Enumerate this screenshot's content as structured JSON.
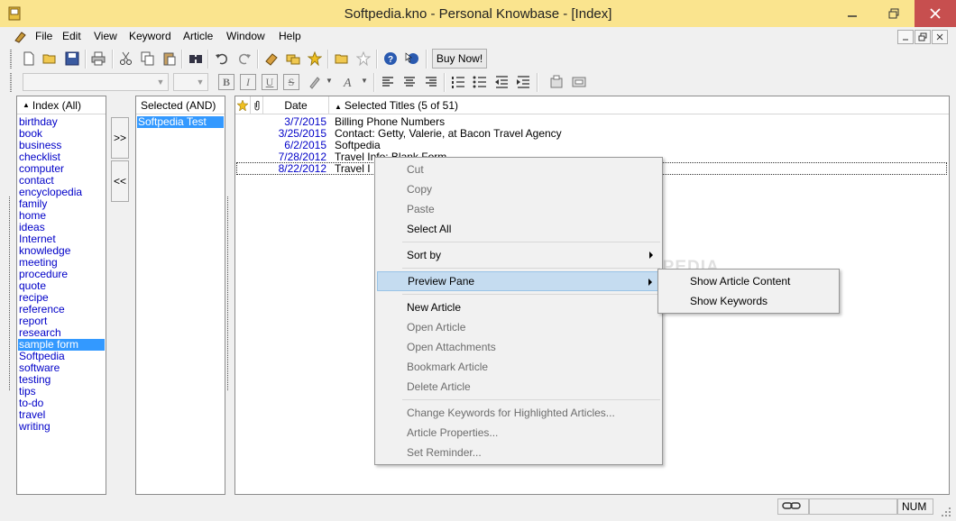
{
  "window": {
    "title": "Softpedia.kno - Personal Knowbase - [Index]",
    "accent_color": "#fae48e",
    "close_color": "#c74f4f"
  },
  "menu": {
    "items": [
      "File",
      "Edit",
      "View",
      "Keyword",
      "Article",
      "Window",
      "Help"
    ]
  },
  "toolbar": {
    "buy_now_label": "Buy Now!",
    "icons": [
      "new-document-icon",
      "open-folder-icon",
      "save-icon",
      "print-icon",
      "cut-icon",
      "copy-icon",
      "paste-icon",
      "find-icon",
      "undo-icon",
      "redo-icon",
      "eraser-icon",
      "bookmark-icon",
      "star-icon",
      "folder-icon",
      "star-outline-icon",
      "help-icon",
      "context-help-icon"
    ]
  },
  "format_toolbar": {
    "font_name": "",
    "font_size": "",
    "bold": "B",
    "italic": "I",
    "underline": "U",
    "strike": "S"
  },
  "index_pane": {
    "header": "Index (All)",
    "keywords": [
      "birthday",
      "book",
      "business",
      "checklist",
      "computer",
      "contact",
      "encyclopedia",
      "family",
      "home",
      "ideas",
      "Internet",
      "knowledge",
      "meeting",
      "procedure",
      "quote",
      "recipe",
      "reference",
      "report",
      "research",
      "sample form",
      "Softpedia",
      "software",
      "testing",
      "tips",
      "to-do",
      "travel",
      "writing"
    ],
    "selected": "sample form"
  },
  "move_buttons": {
    "add": ">>",
    "remove": "<<"
  },
  "selected_pane": {
    "header": "Selected (AND)",
    "items": [
      "Softpedia Test"
    ]
  },
  "titles_pane": {
    "date_header": "Date",
    "title_header": "Selected Titles (5 of 51)",
    "rows": [
      {
        "date": "3/7/2015",
        "title": "Billing Phone Numbers"
      },
      {
        "date": "3/25/2015",
        "title": "Contact: Getty, Valerie, at Bacon Travel Agency"
      },
      {
        "date": "6/2/2015",
        "title": "Softpedia"
      },
      {
        "date": "7/28/2012",
        "title": "Travel Info: Blank Form"
      },
      {
        "date": "8/22/2012",
        "title": "Travel I"
      }
    ]
  },
  "context_menu": {
    "items": [
      {
        "label": "Cut",
        "disabled": true
      },
      {
        "label": "Copy",
        "disabled": true
      },
      {
        "label": "Paste",
        "disabled": true
      },
      {
        "label": "Select All",
        "disabled": false
      },
      {
        "label": "Sort by",
        "disabled": false,
        "submenu": true
      },
      {
        "label": "Preview Pane",
        "disabled": false,
        "submenu": true,
        "highlighted": true
      },
      {
        "label": "New Article",
        "disabled": false
      },
      {
        "label": "Open Article",
        "disabled": true
      },
      {
        "label": "Open Attachments",
        "disabled": true
      },
      {
        "label": "Bookmark Article",
        "disabled": true
      },
      {
        "label": "Delete Article",
        "disabled": true
      },
      {
        "label": "Change Keywords for Highlighted Articles...",
        "disabled": true
      },
      {
        "label": "Article Properties...",
        "disabled": true
      },
      {
        "label": "Set Reminder...",
        "disabled": true
      }
    ]
  },
  "submenu": {
    "items": [
      "Show Article Content",
      "Show Keywords"
    ]
  },
  "watermark": "SOFTPEDIA",
  "status": {
    "num": "NUM"
  }
}
